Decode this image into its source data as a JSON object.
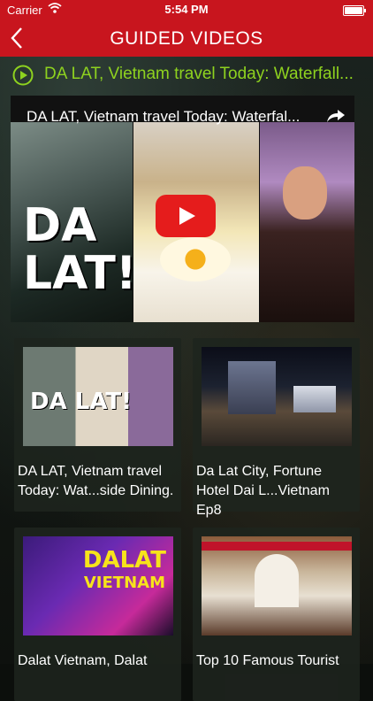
{
  "status_bar": {
    "carrier": "Carrier",
    "time": "5:54 PM"
  },
  "nav": {
    "title": "GUIDED VIDEOS"
  },
  "now_playing": {
    "label": "DA LAT, Vietnam travel Today: Waterfall..."
  },
  "player": {
    "video_title": "DA LAT, Vietnam travel Today: Waterfal...",
    "thumb_text": "DA LAT!"
  },
  "videos": [
    {
      "caption": "DA LAT, Vietnam travel Today: Wat...side Dining.",
      "thumb_text": "DA LAT!"
    },
    {
      "caption": "Da Lat City, Fortune Hotel Dai L...Vietnam Ep8"
    },
    {
      "caption": "Dalat Vietnam, Dalat",
      "thumb_text": "DALAT",
      "thumb_text_2": "VIETNAM"
    },
    {
      "caption": "Top 10 Famous Tourist"
    }
  ],
  "colors": {
    "brand_red": "#c8151e",
    "accent_green": "#8ed21f"
  }
}
